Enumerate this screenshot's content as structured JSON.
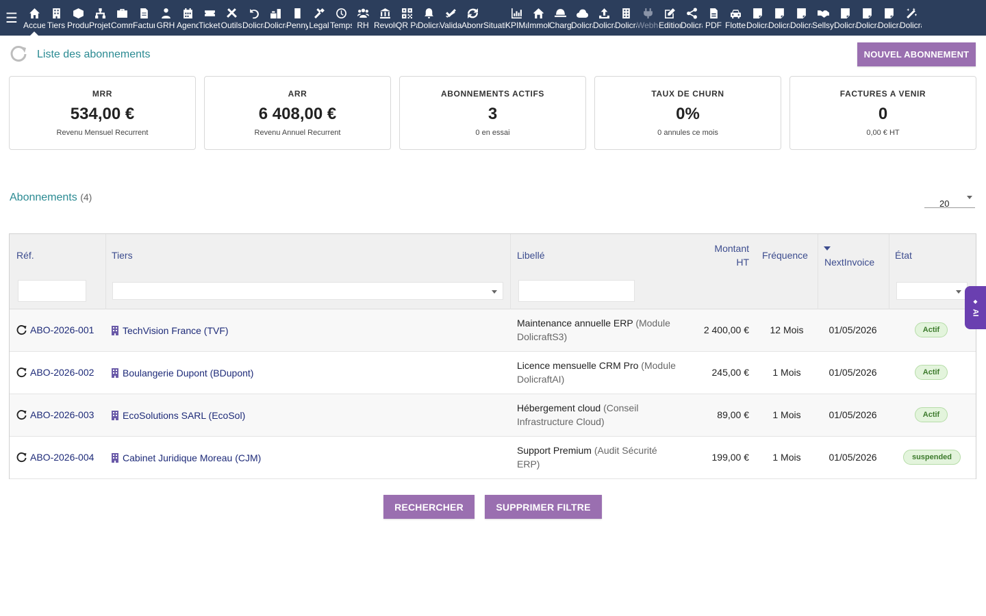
{
  "topbar": {
    "menu_icon": "hamburger-icon",
    "modules": [
      {
        "label": "Accueil",
        "icon": "home-icon",
        "active": true
      },
      {
        "label": "Tiers",
        "icon": "building-icon"
      },
      {
        "label": "Produits",
        "icon": "cube-icon"
      },
      {
        "label": "Projets",
        "icon": "sitemap-icon"
      },
      {
        "label": "Commercial",
        "icon": "briefcase-icon"
      },
      {
        "label": "Facturation",
        "icon": "invoice-icon"
      },
      {
        "label": "GRH",
        "icon": "users-icon"
      },
      {
        "label": "Agenda",
        "icon": "calendar-icon"
      },
      {
        "label": "Tickets",
        "icon": "ticket-icon"
      },
      {
        "label": "Outils",
        "icon": "tools-icon"
      },
      {
        "label": "Dolicraft",
        "icon": "undo-icon"
      },
      {
        "label": "Dolicraft",
        "icon": "blocks-icon"
      },
      {
        "label": "Pennylane",
        "icon": "doc-icon"
      },
      {
        "label": "Legal",
        "icon": "gavel-icon"
      },
      {
        "label": "Temps",
        "icon": "clock-icon"
      },
      {
        "label": "RH",
        "icon": "group-icon"
      },
      {
        "label": "Revolut",
        "icon": "bank-icon"
      },
      {
        "label": "QR Pay",
        "icon": "qrcode-icon"
      },
      {
        "label": "Dolicraft",
        "icon": "bell-icon"
      },
      {
        "label": "Validation",
        "icon": "check-double-icon"
      },
      {
        "label": "Abonnements",
        "icon": "sync-icon"
      },
      {
        "label": "Situation",
        "icon": "blank-icon"
      },
      {
        "label": "KPIManager",
        "icon": "chart-icon"
      },
      {
        "label": "Immobilier",
        "icon": "house-icon"
      },
      {
        "label": "Charges",
        "icon": "hat-icon"
      },
      {
        "label": "Dolicraft",
        "icon": "cloud-icon"
      },
      {
        "label": "Dolicraft",
        "icon": "upload-icon"
      },
      {
        "label": "Dolicraft",
        "icon": "tower-icon"
      },
      {
        "label": "Webhook",
        "icon": "plug-icon",
        "dim": true
      },
      {
        "label": "Edition",
        "icon": "edit-icon"
      },
      {
        "label": "Dolicraft",
        "icon": "share-icon"
      },
      {
        "label": "PDF",
        "icon": "pdf-icon"
      },
      {
        "label": "Flotte",
        "icon": "car-icon"
      },
      {
        "label": "Dolicraft",
        "icon": "note-icon"
      },
      {
        "label": "Dolicraft",
        "icon": "note-icon"
      },
      {
        "label": "Dolicraft",
        "icon": "note-icon"
      },
      {
        "label": "Sellsy",
        "icon": "handshake-icon"
      },
      {
        "label": "Dolicraft",
        "icon": "note-icon"
      },
      {
        "label": "Dolicraft",
        "icon": "note-icon"
      },
      {
        "label": "Dolicraft",
        "icon": "note-icon"
      },
      {
        "label": "Dolicraft",
        "icon": "magic-icon"
      }
    ]
  },
  "header": {
    "title": "Liste des abonnements",
    "new_button": "NOUVEL ABONNEMENT"
  },
  "kpis": [
    {
      "label": "MRR",
      "value": "534,00 €",
      "sub": "Revenu Mensuel Recurrent"
    },
    {
      "label": "ARR",
      "value": "6 408,00 €",
      "sub": "Revenu Annuel Recurrent"
    },
    {
      "label": "ABONNEMENTS ACTIFS",
      "value": "3",
      "sub": "0 en essai"
    },
    {
      "label": "TAUX DE CHURN",
      "value": "0%",
      "sub": "0 annules ce mois"
    },
    {
      "label": "FACTURES A VENIR",
      "value": "0",
      "sub": "0,00 € HT"
    }
  ],
  "list": {
    "title": "Abonnements",
    "count": "(4)",
    "limit": "20"
  },
  "table": {
    "columns": {
      "ref": "Réf.",
      "tiers": "Tiers",
      "libelle": "Libellé",
      "montant_line1": "Montant",
      "montant_line2": "HT",
      "frequence": "Fréquence",
      "next_invoice": "NextInvoice",
      "etat": "État"
    },
    "rows": [
      {
        "ref": "ABO-2026-001",
        "tiers": "TechVision France (TVF)",
        "libelle": "Maintenance annuelle ERP",
        "libelle_sub_a": "(Module",
        "libelle_sub_b": "DolicraftS3)",
        "montant": "2 400,00 €",
        "frequence": "12 Mois",
        "next": "01/05/2026",
        "etat": "Actif"
      },
      {
        "ref": "ABO-2026-002",
        "tiers": "Boulangerie Dupont (BDupont)",
        "libelle": "Licence mensuelle CRM Pro",
        "libelle_sub_a": "(Module",
        "libelle_sub_b": "DolicraftAI)",
        "montant": "245,00 €",
        "frequence": "1 Mois",
        "next": "01/05/2026",
        "etat": "Actif"
      },
      {
        "ref": "ABO-2026-003",
        "tiers": "EcoSolutions SARL (EcoSol)",
        "libelle": "Hébergement cloud",
        "libelle_sub_a": "(Conseil",
        "libelle_sub_b": "Infrastructure Cloud)",
        "montant": "89,00 €",
        "frequence": "1 Mois",
        "next": "01/05/2026",
        "etat": "Actif"
      },
      {
        "ref": "ABO-2026-004",
        "tiers": "Cabinet Juridique Moreau (CJM)",
        "libelle": "Support Premium",
        "libelle_sub_a": "(Audit Sécurité",
        "libelle_sub_b": "ERP)",
        "montant": "199,00 €",
        "frequence": "1 Mois",
        "next": "01/05/2026",
        "etat": "suspended"
      }
    ]
  },
  "actions": {
    "search": "RECHERCHER",
    "clear": "SUPPRIMER FILTRE"
  },
  "ai_tab": {
    "label": "AI"
  },
  "colors": {
    "topbar": "#2c3e5c",
    "accent_purple": "#9a6fb0",
    "title_teal": "#2a8a92",
    "link_navy": "#1d2a78",
    "badge_green_bg": "#e3f4dc"
  }
}
